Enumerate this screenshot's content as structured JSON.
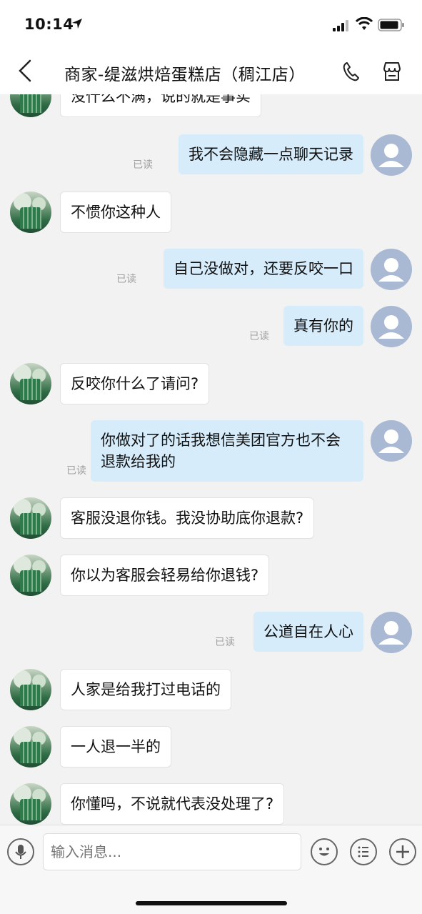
{
  "status_bar": {
    "time": "10:14"
  },
  "header": {
    "title": "商家-缇滋烘焙蛋糕店（稠江店）"
  },
  "read_label": "已读",
  "messages": [
    {
      "side": "left",
      "text": "没什么不满，说的就是事实"
    },
    {
      "side": "right",
      "text": "我不会隐藏一点聊天记录"
    },
    {
      "side": "left",
      "text": "不惯你这种人"
    },
    {
      "side": "right",
      "text": "自己没做对，还要反咬一口"
    },
    {
      "side": "right",
      "text": "真有你的"
    },
    {
      "side": "left",
      "text": "反咬你什么了请问?"
    },
    {
      "side": "right",
      "text": "你做对了的话我想信美团官方也不会退款给我的"
    },
    {
      "side": "left",
      "text": "客服没退你钱。我没协助底你退款?"
    },
    {
      "side": "left",
      "text": "你以为客服会轻易给你退钱?"
    },
    {
      "side": "right",
      "text": "公道自在人心"
    },
    {
      "side": "left",
      "text": "人家是给我打过电话的"
    },
    {
      "side": "left",
      "text": "一人退一半的"
    },
    {
      "side": "left",
      "text": "你懂吗，不说就代表没处理了?"
    }
  ],
  "input": {
    "placeholder": "输入消息..."
  },
  "icons": {
    "back": "chevron-left-icon",
    "phone": "phone-icon",
    "store": "store-icon",
    "voice": "microphone-icon",
    "emoji": "emoji-icon",
    "menu": "list-icon",
    "add": "plus-icon"
  },
  "colors": {
    "user_bubble": "#d6ecfa",
    "merchant_bubble": "#ffffff",
    "user_avatar": "#a9b9d3",
    "background": "#f2f2f2"
  }
}
